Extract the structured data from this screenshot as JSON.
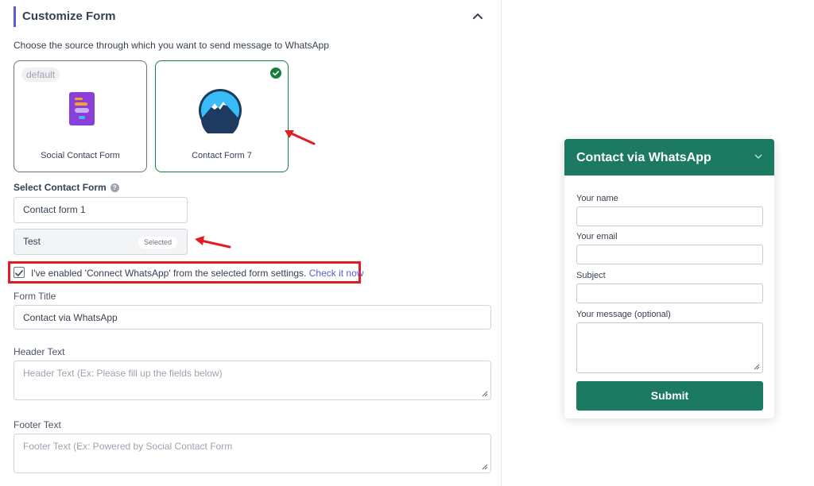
{
  "section": {
    "title": "Customize Form"
  },
  "source_description": "Choose the source through which you want to send message to WhatsApp",
  "sources": [
    {
      "label": "Social Contact Form",
      "badge": "default",
      "icon": "form-phone-icon"
    },
    {
      "label": "Contact Form 7",
      "icon": "mountain-logo-icon",
      "selected": true
    }
  ],
  "select_contact_form": {
    "label": "Select Contact Form",
    "options": [
      {
        "label": "Contact form 1"
      },
      {
        "label": "Test",
        "badge": "Selected"
      }
    ]
  },
  "confirm": {
    "text": "I've enabled 'Connect WhatsApp' from the selected form settings.",
    "link": "Check it now",
    "checked": true
  },
  "form_title": {
    "label": "Form Title",
    "value": "Contact via WhatsApp"
  },
  "header_text": {
    "label": "Header Text",
    "placeholder": "Header Text (Ex: Please fill up the fields below)"
  },
  "footer_text": {
    "label": "Footer Text",
    "placeholder": "Footer Text (Ex: Powered by Social Contact Form"
  },
  "preview": {
    "title": "Contact via WhatsApp",
    "fields": [
      {
        "label": "Your name"
      },
      {
        "label": "Your email"
      },
      {
        "label": "Subject"
      },
      {
        "label": "Your message (optional)"
      }
    ],
    "submit": "Submit"
  },
  "colors": {
    "accent": "#5b5bd6",
    "brand_green": "#1b7a61",
    "selected_border": "#15803d",
    "highlight_red": "#e11d24"
  }
}
